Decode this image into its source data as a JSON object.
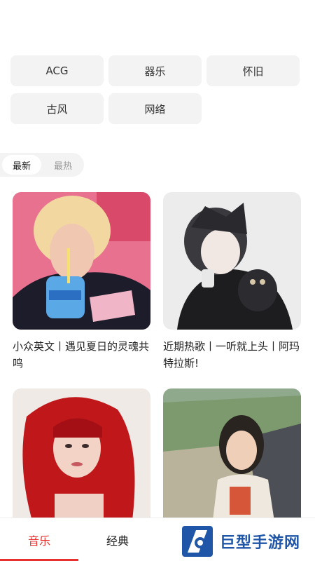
{
  "tags": [
    "ACG",
    "器乐",
    "怀旧",
    "古风",
    "网络"
  ],
  "sort": {
    "newest": "最新",
    "hottest": "最热"
  },
  "playlists": [
    {
      "title": "小众英文丨遇见夏日的灵魂共鸣"
    },
    {
      "title": "近期热歌丨一听就上头丨阿玛特拉斯!"
    },
    {
      "title": ""
    },
    {
      "title": ""
    }
  ],
  "tabbar": {
    "music": "音乐",
    "classic": "经典"
  },
  "watermark": {
    "text": "巨型手游网"
  },
  "colors": {
    "accent": "#e8312f",
    "tag_bg": "#f3f3f3",
    "watermark_blue": "#1f56a8"
  }
}
